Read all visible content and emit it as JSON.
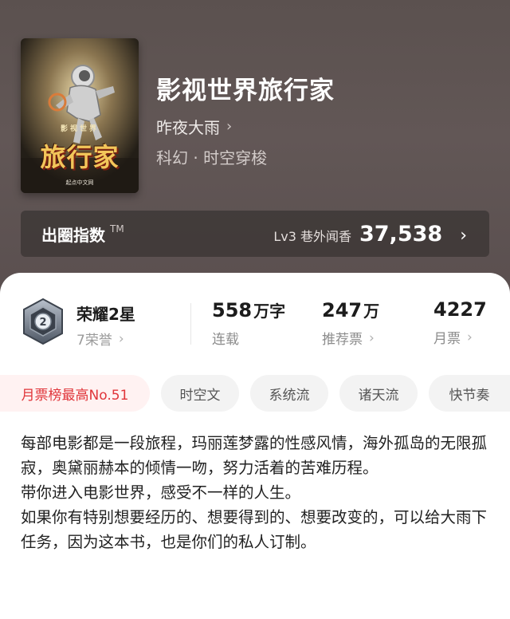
{
  "book": {
    "title": "影视世界旅行家",
    "author": "昨夜大雨",
    "author_chevron": "›",
    "genre": "科幻 · 时空穿梭",
    "cover": {
      "series_label": "影视世界",
      "title": "旅行家",
      "publisher": "起点中文网"
    }
  },
  "index_bar": {
    "label": "出圈指数",
    "tm": "TM",
    "level": "Lv3 巷外闻香",
    "value": "37,538",
    "chevron": "›"
  },
  "honor": {
    "badge_number": "2",
    "title": "荣耀2星",
    "subtitle": "7荣誉",
    "chevron": "›"
  },
  "stats": [
    {
      "value": "558",
      "unit": "万字",
      "label": "连载",
      "chevron": ""
    },
    {
      "value": "247",
      "unit": "万",
      "label": "推荐票",
      "chevron": "›"
    },
    {
      "value": "4227",
      "unit": "",
      "label": "月票",
      "chevron": "›"
    }
  ],
  "tags": [
    {
      "label": "月票榜最高No.51",
      "highlight": true
    },
    {
      "label": "时空文",
      "highlight": false
    },
    {
      "label": "系统流",
      "highlight": false
    },
    {
      "label": "诸天流",
      "highlight": false
    },
    {
      "label": "快节奏",
      "highlight": false
    }
  ],
  "synopsis": [
    "每部电影都是一段旅程，玛丽莲梦露的性感风情，海外孤岛的无限孤寂，奥黛丽赫本的倾情一吻，努力活着的苦难历程。",
    "带你进入电影世界，感受不一样的人生。",
    "如果你有特别想要经历的、想要得到的、想要改变的，可以给大雨下任务，因为这本书，也是你们的私人订制。"
  ],
  "colors": {
    "hero_bg": "#5e5352",
    "highlight_tag_text": "#e0353a",
    "highlight_tag_bg": "#fff2f2"
  }
}
